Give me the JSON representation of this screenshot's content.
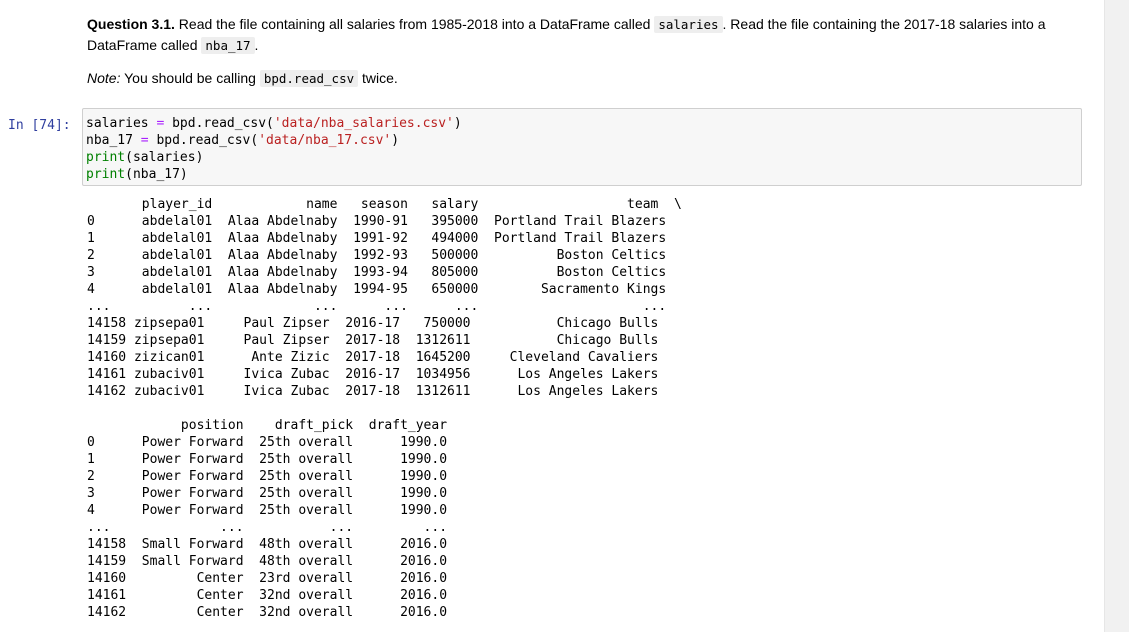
{
  "markdown": {
    "question_label": "Question 3.1.",
    "text_1": " Read the file containing all salaries from 1985-2018 into a DataFrame called ",
    "code_1": "salaries",
    "text_2": ". Read the file containing the 2017-18 salaries into a DataFrame called ",
    "code_2": "nba_17",
    "text_3": ".",
    "note_label": "Note:",
    "note_text": " You should be calling ",
    "note_code": "bpd.read_csv",
    "note_end": " twice."
  },
  "cell": {
    "prompt": "In [74]:",
    "line1": {
      "var": "salaries",
      "eq": "=",
      "call": "bpd.read_csv(",
      "arg": "'data/nba_salaries.csv'",
      "close": ")"
    },
    "line2": {
      "var": "nba_17",
      "eq": "=",
      "call": "bpd.read_csv(",
      "arg": "'data/nba_17.csv'",
      "close": ")"
    },
    "line3": {
      "fn": "print",
      "arg": "(salaries)"
    },
    "line4": {
      "fn": "print",
      "arg": "(nba_17)"
    }
  },
  "output": {
    "lines": [
      "       player_id            name   season   salary                   team  \\",
      "0      abdelal01  Alaa Abdelnaby  1990-91   395000  Portland Trail Blazers",
      "1      abdelal01  Alaa Abdelnaby  1991-92   494000  Portland Trail Blazers",
      "2      abdelal01  Alaa Abdelnaby  1992-93   500000          Boston Celtics",
      "3      abdelal01  Alaa Abdelnaby  1993-94   805000          Boston Celtics",
      "4      abdelal01  Alaa Abdelnaby  1994-95   650000        Sacramento Kings",
      "...          ...             ...      ...      ...                     ...",
      "14158 zipsepa01     Paul Zipser  2016-17   750000           Chicago Bulls",
      "14159 zipsepa01     Paul Zipser  2017-18  1312611           Chicago Bulls",
      "14160 zizican01      Ante Zizic  2017-18  1645200     Cleveland Cavaliers",
      "14161 zubaciv01     Ivica Zubac  2016-17  1034956      Los Angeles Lakers",
      "14162 zubaciv01     Ivica Zubac  2017-18  1312611      Los Angeles Lakers",
      "",
      "            position    draft_pick  draft_year",
      "0      Power Forward  25th overall      1990.0",
      "1      Power Forward  25th overall      1990.0",
      "2      Power Forward  25th overall      1990.0",
      "3      Power Forward  25th overall      1990.0",
      "4      Power Forward  25th overall      1990.0",
      "...              ...           ...         ...",
      "14158  Small Forward  48th overall      2016.0",
      "14159  Small Forward  48th overall      2016.0",
      "14160         Center  23rd overall      2016.0",
      "14161         Center  32nd overall      2016.0",
      "14162         Center  32nd overall      2016.0"
    ]
  }
}
